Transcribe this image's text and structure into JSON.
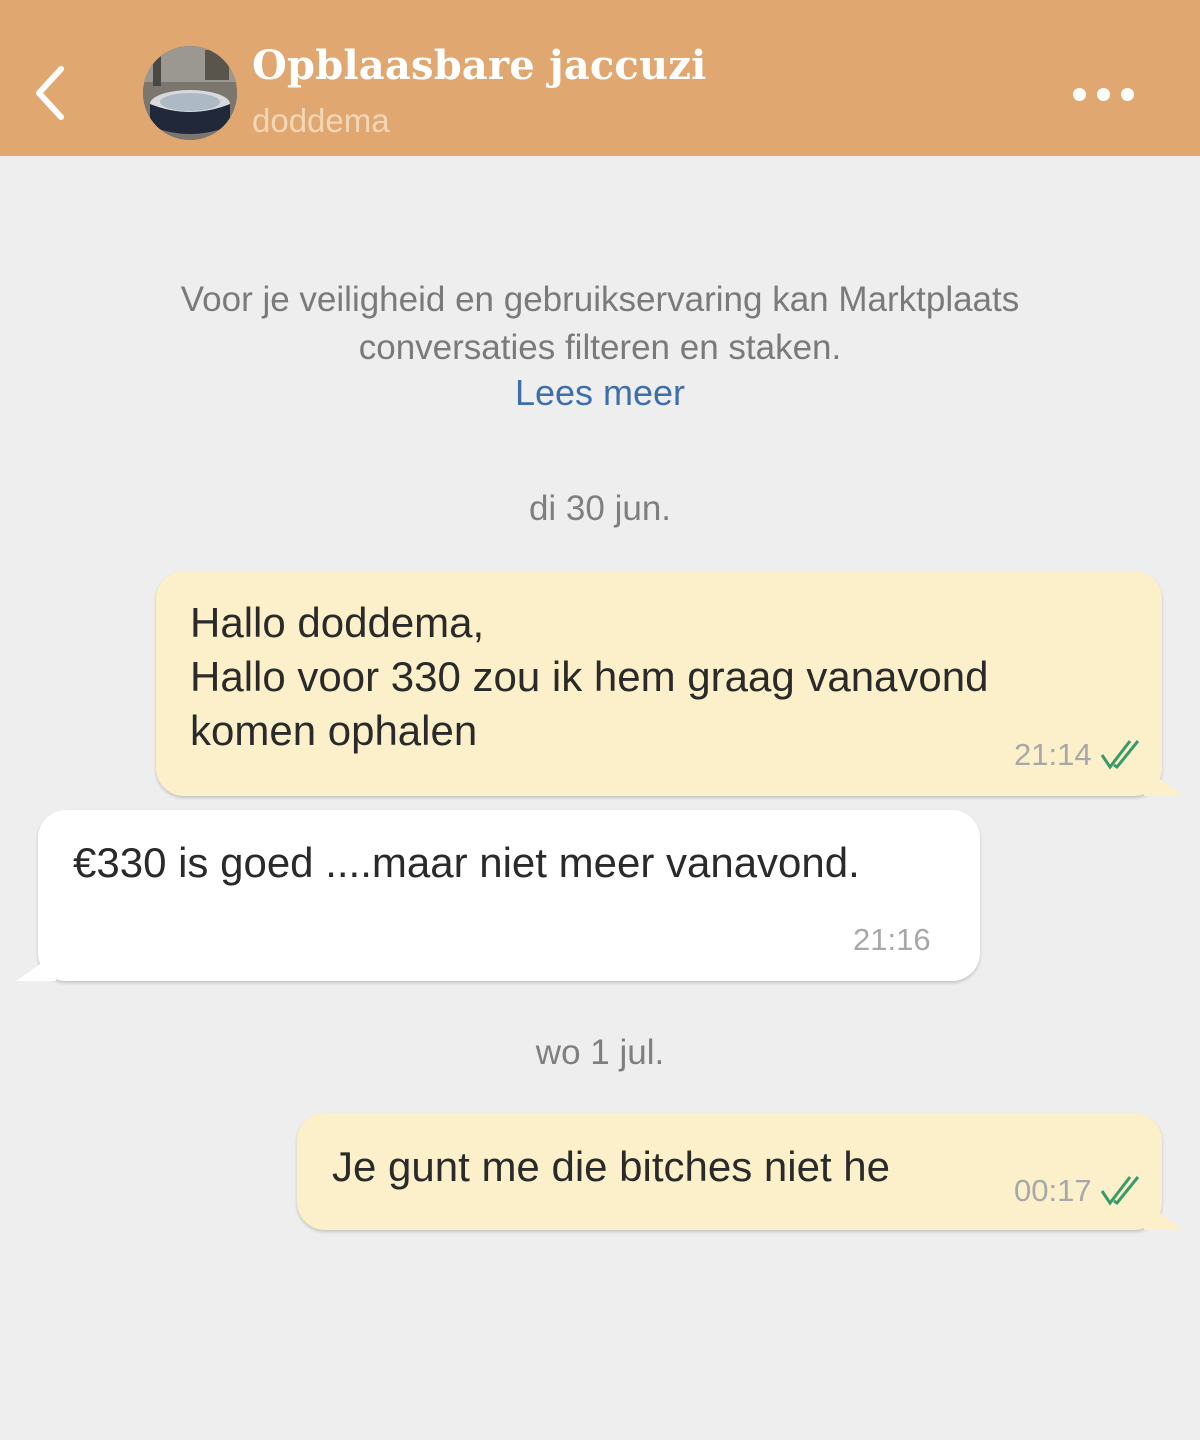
{
  "header": {
    "title": "Opblaasbare jaccuzi",
    "subtitle": "doddema",
    "colors": {
      "bar": "#e0a870",
      "title": "#ffffff",
      "subtitle": "#f3d6b6"
    },
    "icons": {
      "back": "chevron-left-icon",
      "more": "more-horizontal-icon",
      "avatar": "hot-tub-thumbnail"
    }
  },
  "notice": {
    "lines": [
      "Voor je veiligheid en gebruikservaring kan Marktplaats",
      "conversaties filteren en staken."
    ],
    "link": "Lees meer",
    "link_color": "#3f6fa8"
  },
  "conversation": {
    "date_1": "di 30 jun.",
    "date_2": "wo 1 jul.",
    "messages": [
      {
        "direction": "outgoing",
        "lines": [
          "Hallo doddema,",
          "Hallo voor 330 zou ik hem graag vanavond",
          "komen ophalen"
        ],
        "time": "21:14",
        "status": "read"
      },
      {
        "direction": "incoming",
        "lines": [
          "€330 is goed ....maar niet meer vanavond."
        ],
        "time": "21:16"
      },
      {
        "direction": "outgoing",
        "lines": [
          "Je gunt me die bitches niet he"
        ],
        "time": "00:17",
        "status": "read"
      }
    ],
    "colors": {
      "outgoing_bubble": "#fbf0c9",
      "incoming_bubble": "#ffffff",
      "read_ticks": "#3a9a6a",
      "background": "#efeeee"
    }
  }
}
